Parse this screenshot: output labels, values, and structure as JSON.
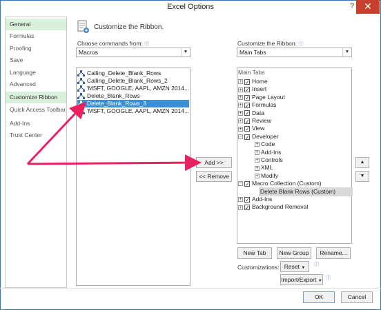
{
  "window": {
    "title": "Excel Options",
    "help_glyph": "?",
    "close_glyph": "✕"
  },
  "nav": {
    "items": [
      "General",
      "Formulas",
      "Proofing",
      "Save",
      "Language",
      "Advanced",
      "Customize Ribbon",
      "Quick Access Toolbar",
      "Add-Ins",
      "Trust Center"
    ],
    "selected": "General",
    "highlight": "Customize Ribbon"
  },
  "header": {
    "title": "Customize the Ribbon."
  },
  "left_panel": {
    "label": "Choose commands from:",
    "select_value": "Macros",
    "items": [
      "Calling_Delete_Blank_Rows",
      "Calling_Delete_Blank_Rows_2",
      "'MSFT, GOOGLE, AAPL, AMZN 2014...",
      "Delete_Blank_Rows",
      "Delete_Blank_Rows_3",
      "'MSFT, GOOGLE, AAPL, AMZN 2014..."
    ],
    "selected_index": 4
  },
  "middle": {
    "add_label": "Add >>",
    "remove_label": "<< Remove"
  },
  "right_panel": {
    "label": "Customize the Ribbon:",
    "select_value": "Main Tabs",
    "tree_header": "Main Tabs",
    "tree": [
      {
        "label": "Home",
        "level": 0,
        "exp": "+",
        "chk": true
      },
      {
        "label": "Insert",
        "level": 0,
        "exp": "+",
        "chk": true
      },
      {
        "label": "Page Layout",
        "level": 0,
        "exp": "+",
        "chk": true
      },
      {
        "label": "Formulas",
        "level": 0,
        "exp": "+",
        "chk": true
      },
      {
        "label": "Data",
        "level": 0,
        "exp": "+",
        "chk": true
      },
      {
        "label": "Review",
        "level": 0,
        "exp": "+",
        "chk": true
      },
      {
        "label": "View",
        "level": 0,
        "exp": "+",
        "chk": true
      },
      {
        "label": "Developer",
        "level": 0,
        "exp": "−",
        "chk": true
      },
      {
        "label": "Code",
        "level": 1,
        "exp": "+",
        "chk": null
      },
      {
        "label": "Add-Ins",
        "level": 1,
        "exp": "+",
        "chk": null
      },
      {
        "label": "Controls",
        "level": 1,
        "exp": "+",
        "chk": null
      },
      {
        "label": "XML",
        "level": 1,
        "exp": "+",
        "chk": null
      },
      {
        "label": "Modify",
        "level": 1,
        "exp": "+",
        "chk": null
      },
      {
        "label": "Macro Collection (Custom)",
        "level": 0,
        "exp": "−",
        "chk": true
      },
      {
        "label": "Delete Blank Rows (Custom)",
        "level": 2,
        "exp": null,
        "chk": null,
        "selected": true
      },
      {
        "label": "Add-Ins",
        "level": 0,
        "exp": "+",
        "chk": true
      },
      {
        "label": "Background Removal",
        "level": 0,
        "exp": "+",
        "chk": true
      }
    ],
    "up_glyph": "▲",
    "down_glyph": "▼",
    "new_tab": "New Tab",
    "new_group": "New Group",
    "rename": "Rename...",
    "customizations_label": "Customizations:",
    "reset": "Reset",
    "import_export": "Import/Export"
  },
  "footer": {
    "ok": "OK",
    "cancel": "Cancel"
  },
  "colors": {
    "accent": "#3a8fd6",
    "arrow": "#e8225f",
    "nav_selected": "#d9f0da",
    "close": "#c7402c"
  }
}
